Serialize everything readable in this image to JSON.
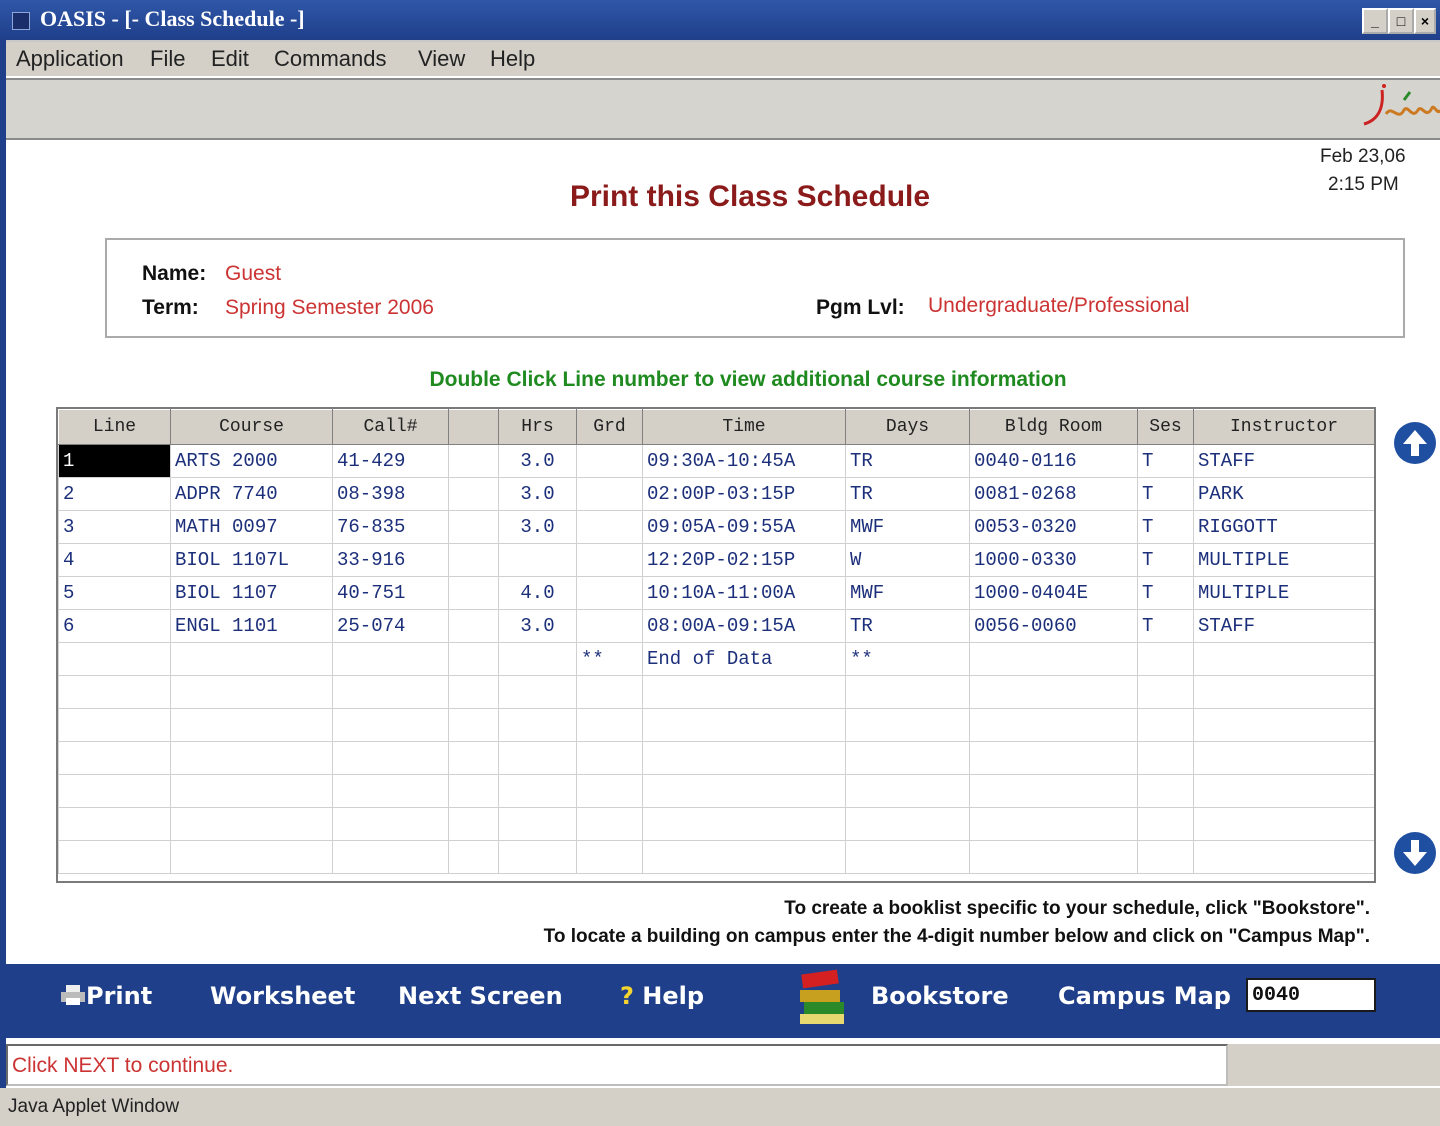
{
  "window": {
    "title": "OASIS - [- Class Schedule -]"
  },
  "menu": [
    "Application",
    "File",
    "Edit",
    "Commands",
    "View",
    "Help"
  ],
  "header": {
    "date": "Feb 23,06",
    "time": "2:15 PM",
    "title": "Print this Class Schedule"
  },
  "info": {
    "name_label": "Name:",
    "name_value": "Guest",
    "term_label": "Term:",
    "term_value": "Spring Semester 2006",
    "pgm_label": "Pgm Lvl:",
    "pgm_value": "Undergraduate/Professional"
  },
  "instruction": "Double Click Line number to view additional course information",
  "table": {
    "columns": [
      "Line",
      "Course",
      "Call#",
      "",
      "Hrs",
      "Grd",
      "Time",
      "Days",
      "Bldg Room",
      "Ses",
      "Instructor"
    ],
    "rows": [
      [
        "1",
        "ARTS 2000",
        "41-429",
        "",
        "3.0",
        "",
        "09:30A-10:45A",
        "TR",
        "0040-0116",
        "T",
        "STAFF"
      ],
      [
        "2",
        "ADPR 7740",
        "08-398",
        "",
        "3.0",
        "",
        "02:00P-03:15P",
        "TR",
        "0081-0268",
        "T",
        "PARK"
      ],
      [
        "3",
        "MATH 0097",
        "76-835",
        "",
        "3.0",
        "",
        "09:05A-09:55A",
        "MWF",
        "0053-0320",
        "T",
        "RIGGOTT"
      ],
      [
        "4",
        "BIOL 1107L",
        "33-916",
        "",
        "",
        "",
        "12:20P-02:15P",
        "W",
        "1000-0330",
        "T",
        "MULTIPLE"
      ],
      [
        "5",
        "BIOL 1107",
        "40-751",
        "",
        "4.0",
        "",
        "10:10A-11:00A",
        "MWF",
        "1000-0404E",
        "T",
        "MULTIPLE"
      ],
      [
        "6",
        "ENGL 1101",
        "25-074",
        "",
        "3.0",
        "",
        "08:00A-09:15A",
        "TR",
        "0056-0060",
        "T",
        "STAFF"
      ],
      [
        "",
        "",
        "",
        "",
        "",
        "**",
        "End of Data",
        "**",
        "",
        "",
        ""
      ]
    ]
  },
  "notes": {
    "bookstore": "To create a booklist specific to your schedule, click \"Bookstore\".",
    "campus": "To locate a building on campus enter the 4-digit number below and click on \"Campus Map\"."
  },
  "actions": {
    "print": "Print",
    "worksheet": "Worksheet",
    "next": "Next Screen",
    "help_glyph": "?",
    "help": "Help",
    "bookstore": "Bookstore",
    "campus_map": "Campus Map",
    "campus_value": "0040"
  },
  "status": "Click NEXT to continue.",
  "java": "Java Applet Window",
  "colors": {
    "title_bar": "#1f3f8a",
    "accent_red": "#8b1a1a",
    "value_red": "#cc3333",
    "instruction_green": "#1f8a1f",
    "action_bar": "#1f3f8a"
  }
}
